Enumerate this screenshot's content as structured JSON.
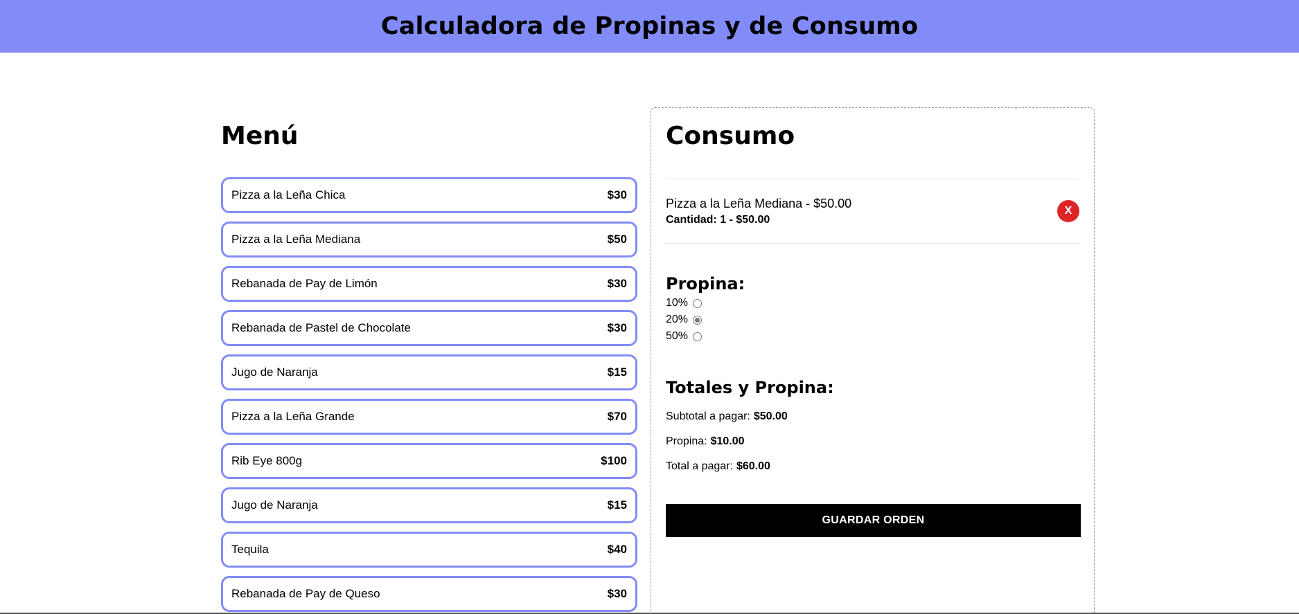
{
  "header": {
    "title": "Calculadora de Propinas y de Consumo"
  },
  "menu": {
    "title": "Menú",
    "items": [
      {
        "name": "Pizza a la Leña Chica",
        "price": "$30"
      },
      {
        "name": "Pizza a la Leña Mediana",
        "price": "$50"
      },
      {
        "name": "Rebanada de Pay de Limón",
        "price": "$30"
      },
      {
        "name": "Rebanada de Pastel de Chocolate",
        "price": "$30"
      },
      {
        "name": "Jugo de Naranja",
        "price": "$15"
      },
      {
        "name": "Pizza a la Leña Grande",
        "price": "$70"
      },
      {
        "name": "Rib Eye 800g",
        "price": "$100"
      },
      {
        "name": "Jugo de Naranja",
        "price": "$15"
      },
      {
        "name": "Tequila",
        "price": "$40"
      },
      {
        "name": "Rebanada de Pay de Queso",
        "price": "$30"
      }
    ]
  },
  "consumo": {
    "title": "Consumo",
    "order": [
      {
        "title": "Pizza a la Leña Mediana - $50.00",
        "qty": "Cantidad: 1 - $50.00",
        "remove_label": "X"
      }
    ],
    "propina": {
      "title": "Propina:",
      "options": [
        {
          "label": "10%",
          "checked": false
        },
        {
          "label": "20%",
          "checked": true
        },
        {
          "label": "50%",
          "checked": false
        }
      ]
    },
    "totales": {
      "title": "Totales y Propina:",
      "subtotal_label": "Subtotal a pagar:",
      "subtotal": "$50.00",
      "propina_label": "Propina:",
      "propina": "$10.00",
      "total_label": "Total a pagar:",
      "total": "$60.00"
    },
    "save_label": "GUARDAR ORDEN"
  },
  "colors": {
    "accent": "#818cf8",
    "danger": "#dc2626",
    "button": "#000000"
  }
}
